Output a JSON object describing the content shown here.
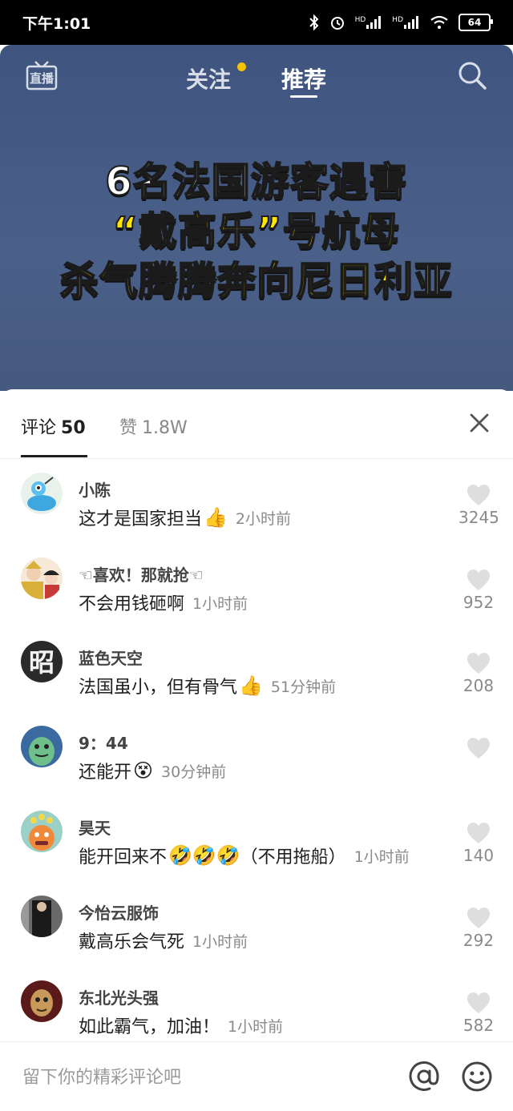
{
  "status_bar": {
    "time": "下午1:01",
    "battery": "64",
    "signal_label_1": "HD",
    "signal_label_2": "HD"
  },
  "top_nav": {
    "live_label": "直播",
    "follow_label": "关注",
    "recommend_label": "推荐"
  },
  "video": {
    "headline_line1": "6名法国游客遇害",
    "headline_line2": "“戴高乐”号航母",
    "headline_line3": "杀气腾腾奔向尼日利亚"
  },
  "panel": {
    "comments_tab_label": "评论",
    "comments_count": "50",
    "likes_tab_label": "赞",
    "likes_count": "1.8W"
  },
  "comments": [
    {
      "username": "小陈",
      "text": "这才是国家担当",
      "emoji": "👍",
      "time": "2小时前",
      "likes": "3245"
    },
    {
      "username": "☜喜欢！那就抢☜",
      "text": "不会用钱砸啊",
      "emoji": "",
      "time": "1小时前",
      "likes": "952"
    },
    {
      "username": "蓝色天空",
      "text": "法国虽小，但有骨气",
      "emoji": "👍",
      "time": "51分钟前",
      "likes": "208"
    },
    {
      "username": "9：44",
      "text": "还能开",
      "emoji": "😵",
      "time": "30分钟前",
      "likes": ""
    },
    {
      "username": "昊天",
      "text": "能开回来不",
      "emoji": "🤣🤣🤣",
      "text_after": "（不用拖船）",
      "time": "1小时前",
      "likes": "140"
    },
    {
      "username": "今怡云服饰",
      "text": "戴高乐会气死",
      "emoji": "",
      "time": "1小时前",
      "likes": "292"
    },
    {
      "username": "东北光头强",
      "text": "如此霸气，加油！",
      "emoji": "",
      "time": "1小时前",
      "likes": "582"
    }
  ],
  "input": {
    "placeholder": "留下你的精彩评论吧"
  },
  "avatar_glyphs": {
    "c3": "昭"
  },
  "colors": {
    "accent_yellow": "#ffe500",
    "follow_dot": "#f5c400",
    "video_bg": "#4a6089"
  }
}
